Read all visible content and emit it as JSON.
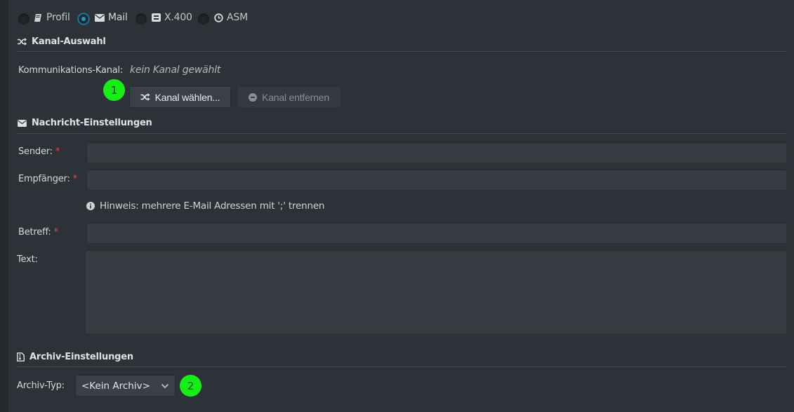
{
  "message_type": {
    "options": [
      {
        "label": "Profil",
        "icon": "book-icon",
        "checked": false
      },
      {
        "label": "Mail",
        "icon": "envelope-icon",
        "checked": true
      },
      {
        "label": "X.400",
        "icon": "x400-envelope-icon",
        "checked": false
      },
      {
        "label": "ASM",
        "icon": "clock-icon",
        "checked": false
      }
    ]
  },
  "kanal": {
    "section_title": "Kanal-Auswahl",
    "section_icon": "shuffle-icon",
    "label": "Kommunikations-Kanal:",
    "value": "kein Kanal gewählt",
    "choose_button": "Kanal wählen...",
    "remove_button": "Kanal entfernen"
  },
  "nachricht": {
    "section_title": "Nachricht-Einstellungen",
    "section_icon": "envelope-icon",
    "sender_label": "Sender:",
    "sender_value": "",
    "recipient_label": "Empfänger:",
    "recipient_value": "",
    "hint": "Hinweis: mehrere E-Mail Adressen mit ';' trennen",
    "subject_label": "Betreff:",
    "subject_value": "",
    "text_label": "Text:",
    "text_value": "",
    "required_marker": "*"
  },
  "archiv": {
    "section_title": "Archiv-Einstellungen",
    "section_icon": "file-archive-icon",
    "type_label": "Archiv-Typ:",
    "type_value": "<Kein Archiv>"
  },
  "markers": [
    "1",
    "2"
  ],
  "colors": {
    "background": "#2d3238",
    "accent": "#1a9bd0",
    "required": "#e0454a",
    "marker": "#14f014"
  }
}
